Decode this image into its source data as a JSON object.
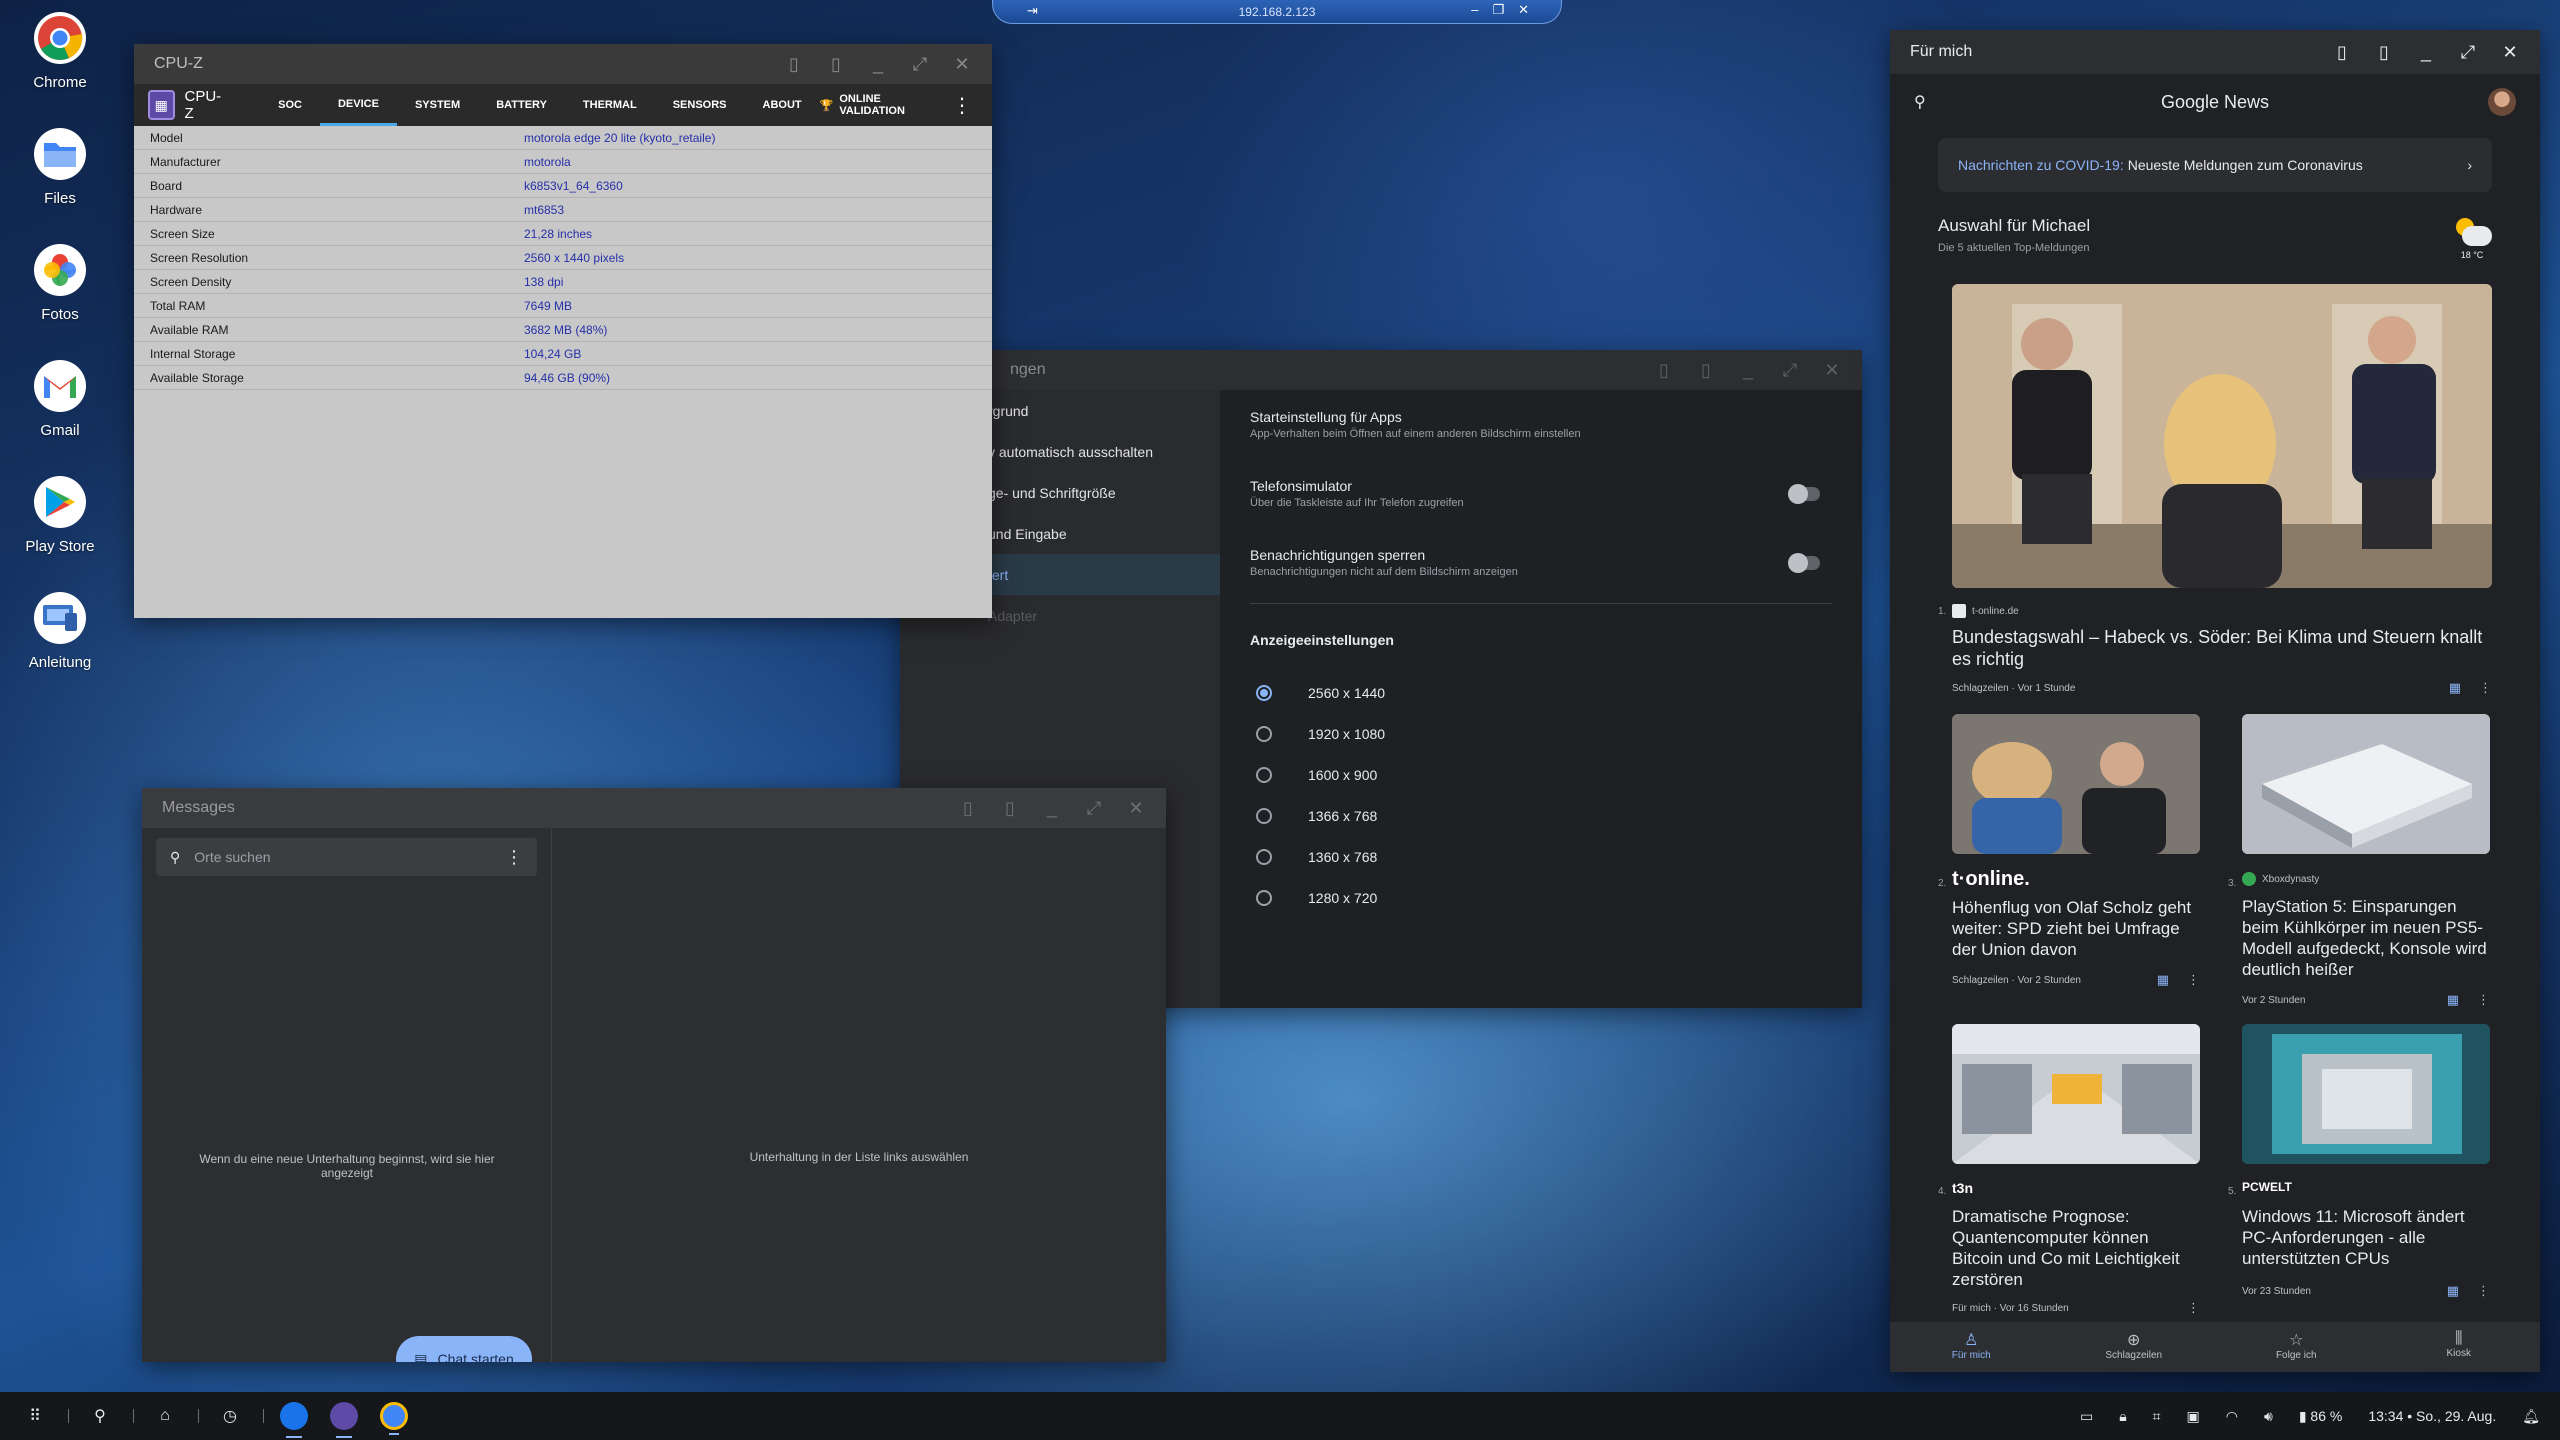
{
  "remote": {
    "host": "192.168.2.123",
    "pin": "⇥",
    "ctrls": [
      "–",
      "❐",
      "✕"
    ]
  },
  "desktop": {
    "icons": [
      {
        "label": "Chrome"
      },
      {
        "label": "Files"
      },
      {
        "label": "Fotos"
      },
      {
        "label": "Gmail"
      },
      {
        "label": "Play Store"
      },
      {
        "label": "Anleitung"
      }
    ]
  },
  "cpuz": {
    "title": "CPU-Z",
    "app_name": "CPU-Z",
    "tabs": [
      "SOC",
      "DEVICE",
      "SYSTEM",
      "BATTERY",
      "THERMAL",
      "SENSORS",
      "ABOUT"
    ],
    "active_tab": "DEVICE",
    "online_validation": "ONLINE VALIDATION",
    "rows": [
      {
        "k": "Model",
        "v": "motorola edge 20 lite (kyoto_retaile)"
      },
      {
        "k": "Manufacturer",
        "v": "motorola"
      },
      {
        "k": "Board",
        "v": "k6853v1_64_6360"
      },
      {
        "k": "Hardware",
        "v": "mt6853"
      },
      {
        "k": "Screen Size",
        "v": "21,28 inches"
      },
      {
        "k": "Screen Resolution",
        "v": "2560 x 1440 pixels"
      },
      {
        "k": "Screen Density",
        "v": "138 dpi"
      },
      {
        "k": "Total RAM",
        "v": "7649 MB"
      },
      {
        "k": "Available RAM",
        "v": "3682 MB  (48%)"
      },
      {
        "k": "Internal Storage",
        "v": "104,24 GB"
      },
      {
        "k": "Available Storage",
        "v": "94,46 GB (90%)"
      }
    ]
  },
  "settings": {
    "title": "ngen",
    "nav": [
      {
        "label": "rgrund",
        "state": "normal"
      },
      {
        "label": "y automatisch ausschalten",
        "state": "normal"
      },
      {
        "label": "ge- und Schriftgröße",
        "state": "normal"
      },
      {
        "label": "und Eingabe",
        "state": "normal"
      },
      {
        "label": "tert",
        "state": "active"
      },
      {
        "label": "Adapter",
        "state": "disabled"
      }
    ],
    "rows": [
      {
        "title": "Starteinstellung für Apps",
        "sub": "App-Verhalten beim Öffnen auf einem anderen Bildschirm einstellen",
        "toggle": false
      },
      {
        "title": "Telefonsimulator",
        "sub": "Über die Taskleiste auf Ihr Telefon zugreifen",
        "toggle": true
      },
      {
        "title": "Benachrichtigungen sperren",
        "sub": "Benachrichtigungen nicht auf dem Bildschirm anzeigen",
        "toggle": true
      }
    ],
    "section": "Anzeigeeinstellungen",
    "resolutions": [
      "2560 x 1440",
      "1920 x 1080",
      "1600 x 900",
      "1366 x 768",
      "1360 x 768",
      "1280 x 720"
    ],
    "selected_resolution": "2560 x 1440"
  },
  "messages": {
    "title": "Messages",
    "search_placeholder": "Orte suchen",
    "empty_left": "Wenn du eine neue Unterhaltung beginnst, wird sie hier angezeigt",
    "empty_right": "Unterhaltung in der Liste links auswählen",
    "chat_button": "Chat starten"
  },
  "news": {
    "window_title": "Für mich",
    "app_title": "Google News",
    "covid_link": "Nachrichten zu COVID-19:",
    "covid_text": "Neueste Meldungen zum Coronavirus",
    "section_title": "Auswahl für Michael",
    "section_sub": "Die 5 aktuellen Top-Meldungen",
    "weather_temp": "18 °C",
    "articles": [
      {
        "n": "1.",
        "source": "t-online.de",
        "headline": "Bundestagswahl – Habeck vs. Söder: Bei Klima und Steuern knallt es richtig",
        "meta": "Schlagzeilen · Vor 1 Stunde"
      },
      {
        "n": "2.",
        "source": "t·online.",
        "headline": "Höhenflug von Olaf Scholz geht weiter: SPD zieht bei Umfrage der Union davon",
        "meta": "Schlagzeilen · Vor 2 Stunden"
      },
      {
        "n": "3.",
        "source": "Xboxdynasty",
        "headline": "PlayStation 5: Einsparungen beim Kühlkörper im neuen PS5-Modell aufgedeckt, Konsole wird deutlich heißer",
        "meta": "Vor 2 Stunden"
      },
      {
        "n": "4.",
        "source": "t3n",
        "headline": "Dramatische Prognose: Quantencomputer können Bitcoin und Co mit Leichtigkeit zerstören",
        "meta": "Für mich · Vor 16 Stunden"
      },
      {
        "n": "5.",
        "source": "PCWELT",
        "headline": "Windows 11: Microsoft ändert PC-Anforderungen - alle unterstützten CPUs",
        "meta": "Vor 23 Stunden"
      }
    ],
    "nav": [
      {
        "label": "Für mich",
        "glyph": "♙"
      },
      {
        "label": "Schlagzeilen",
        "glyph": "⊕"
      },
      {
        "label": "Folge ich",
        "glyph": "☆"
      },
      {
        "label": "Kiosk",
        "glyph": "⫼"
      }
    ]
  },
  "taskbar": {
    "battery": "86 %",
    "clock": "13:34 • So., 29. Aug."
  }
}
